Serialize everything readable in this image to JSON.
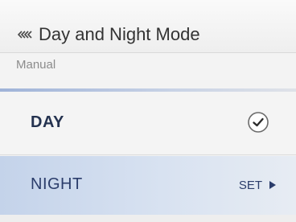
{
  "header": {
    "back_icon": "back-chevrons-icon",
    "title": "Day and Night Mode"
  },
  "mode": {
    "label": "Manual"
  },
  "options": [
    {
      "label": "DAY",
      "selected": true,
      "icon": "check-circle-icon"
    },
    {
      "label": "NIGHT",
      "action_label": "SET",
      "icon": "triangle-right-icon"
    }
  ],
  "colors": {
    "text_dark": "#333333",
    "option_text": "#24324f",
    "highlight": "#c4d3ea",
    "divider": "#9fb3d8"
  }
}
